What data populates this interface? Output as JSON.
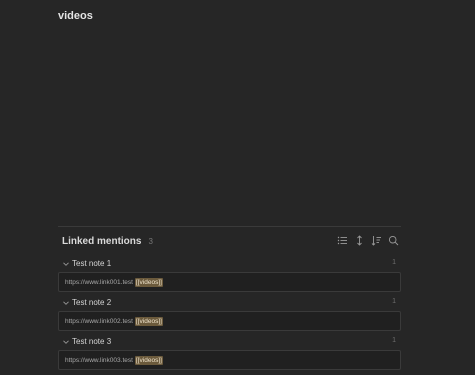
{
  "note": {
    "title": "videos"
  },
  "backlinks": {
    "title": "Linked mentions",
    "count": "3",
    "tools": [
      {
        "icon": "list-icon"
      },
      {
        "icon": "expand-vertical-icon"
      },
      {
        "icon": "sort-icon"
      },
      {
        "icon": "search-icon"
      }
    ],
    "groups": [
      {
        "name": "Test note 1",
        "count": "1",
        "url": "https://www.link001.test",
        "link": "[[videos]]"
      },
      {
        "name": "Test note 2",
        "count": "1",
        "url": "https://www.link002.test",
        "link": "[[videos]]"
      },
      {
        "name": "Test note 3",
        "count": "1",
        "url": "https://www.link003.test",
        "link": "[[videos]]"
      }
    ]
  },
  "colors": {
    "background": "#262626",
    "highlight": "#6b5a3c"
  }
}
